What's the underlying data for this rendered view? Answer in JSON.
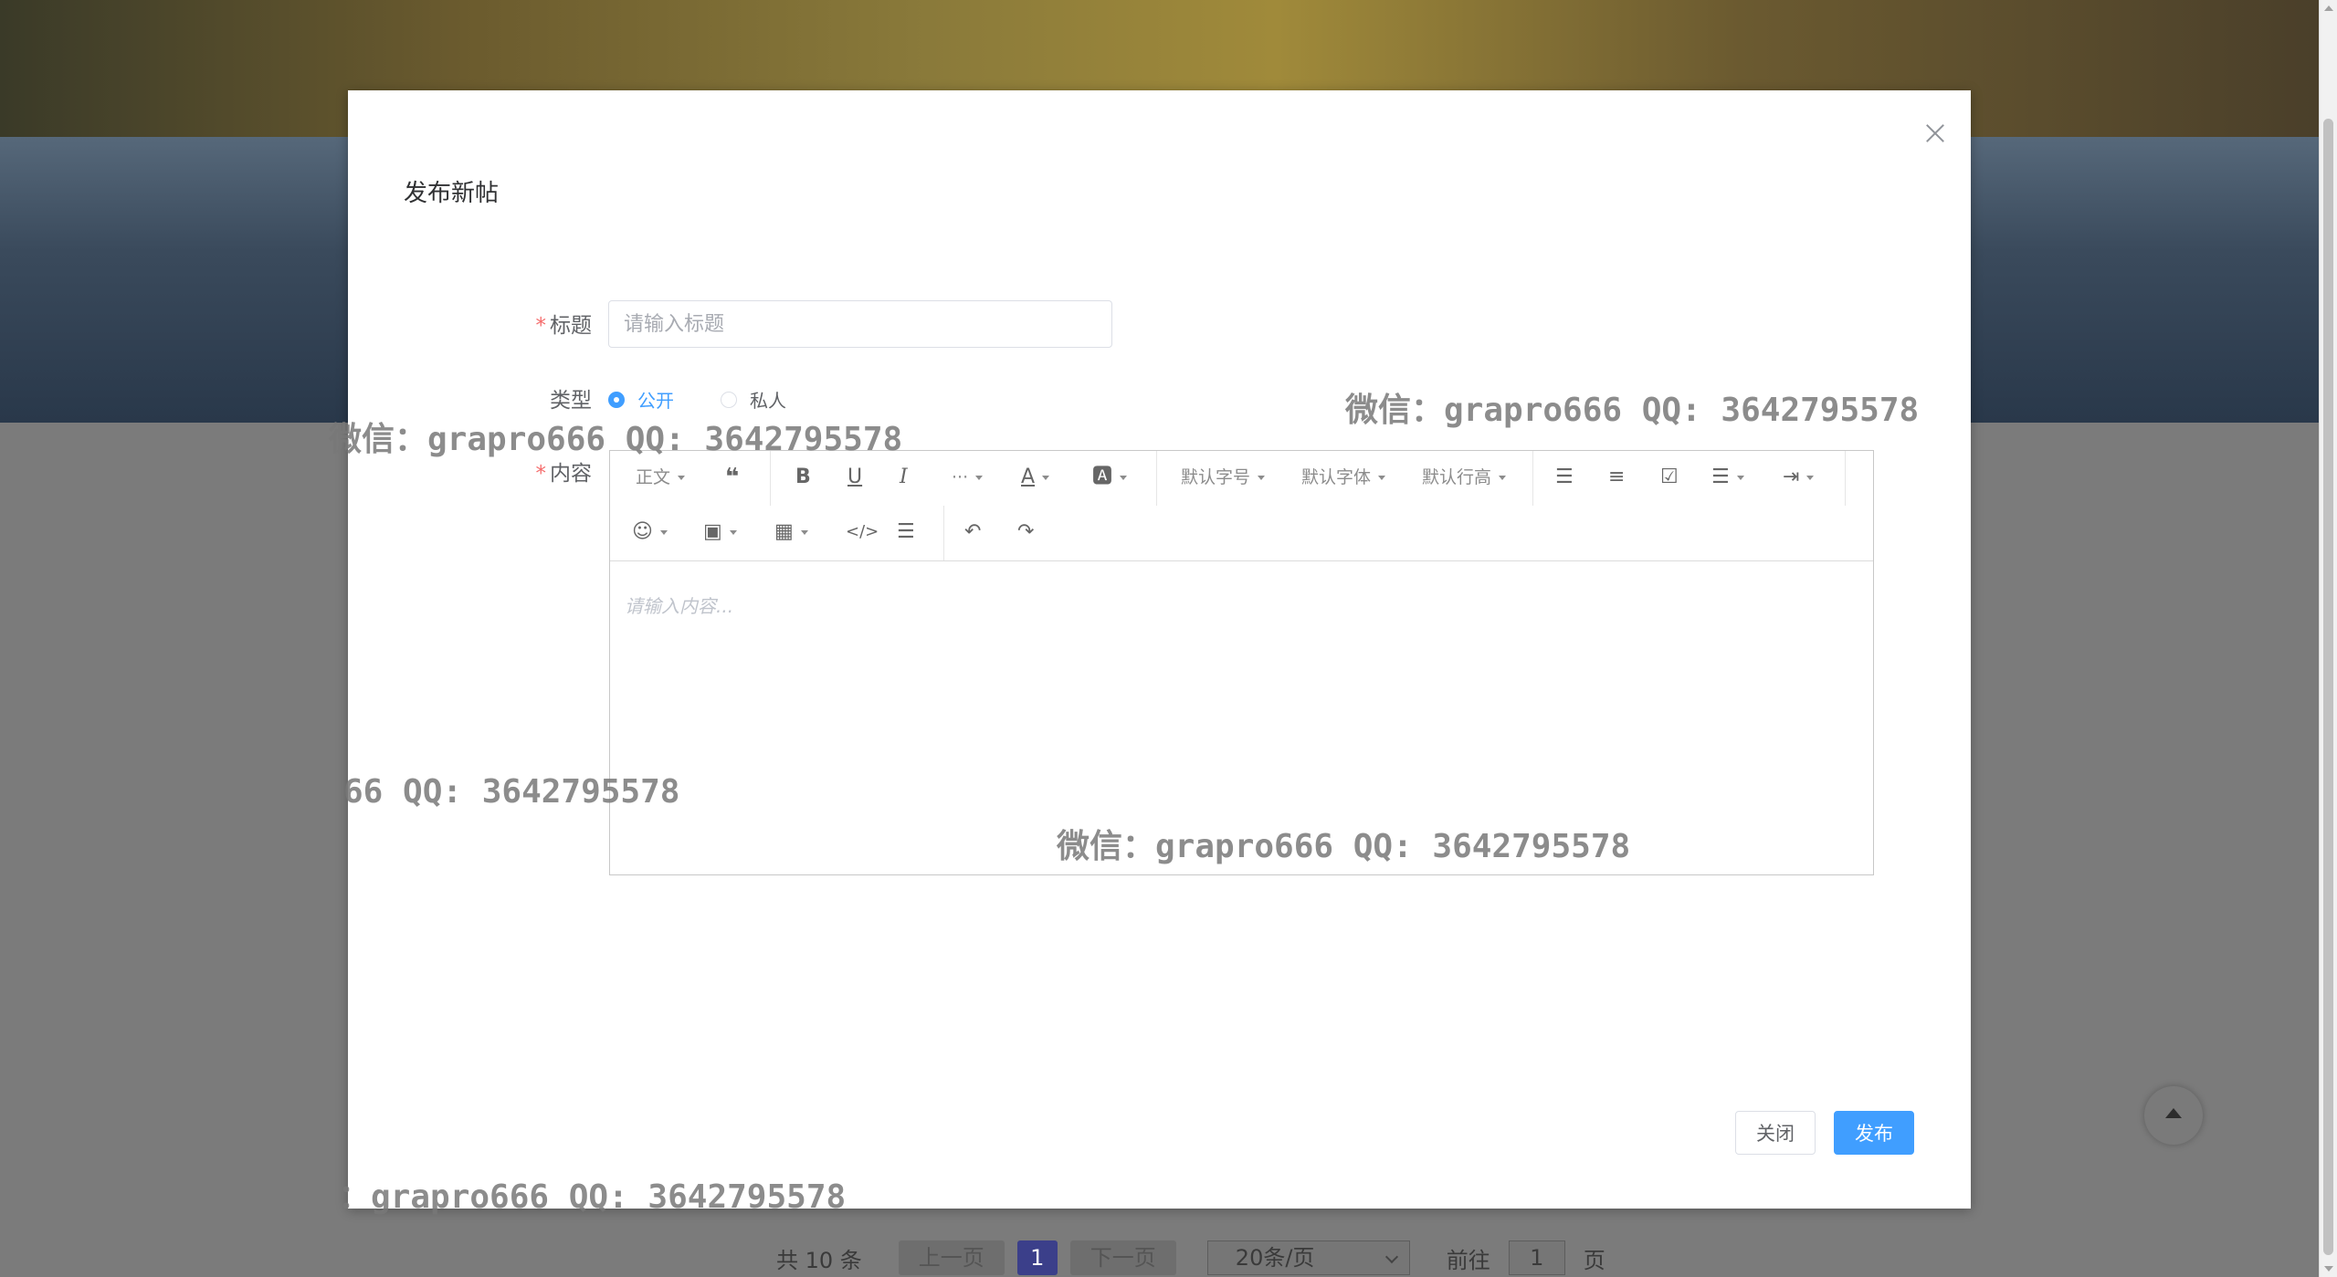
{
  "dialog": {
    "title": "发布新帖",
    "close_icon": "close-icon"
  },
  "form": {
    "title_label": "标题",
    "title_placeholder": "请输入标题",
    "type_label": "类型",
    "type_options": [
      {
        "label": "公开",
        "checked": true
      },
      {
        "label": "私人",
        "checked": false
      }
    ],
    "content_label": "内容",
    "required_mark": "*"
  },
  "editor": {
    "paragraph": "正文",
    "font_size": "默认字号",
    "font_family": "默认字体",
    "line_height": "默认行高",
    "more": "···",
    "placeholder": "请输入内容...",
    "icons": [
      "quote-icon",
      "bold-icon",
      "underline-icon",
      "italic-icon",
      "font-color-icon",
      "background-color-icon",
      "bulleted-list-icon",
      "numbered-list-icon",
      "todo-icon",
      "align-icon",
      "indent-icon",
      "emoji-icon",
      "image-icon",
      "table-icon",
      "code-icon",
      "divider-icon",
      "undo-icon",
      "redo-icon"
    ]
  },
  "buttons": {
    "close": "关闭",
    "publish": "发布"
  },
  "pagination": {
    "total": "共 10 条",
    "prev": "上一页",
    "current": "1",
    "next": "下一页",
    "page_size": "20条/页",
    "goto_prefix": "前往",
    "goto_value": "1",
    "goto_suffix": "页"
  },
  "watermarks": {
    "w1": "微信：grapro666 QQ: 3642795578",
    "w2": "微信：grapro666 QQ: 3642795578",
    "w3": "66 QQ: 3642795578",
    "w4": "微信：grapro666 QQ: 3642795578",
    "w5": "：grapro666 QQ: 3642795578"
  },
  "colors": {
    "primary": "#409eff",
    "required": "#f56c6c"
  }
}
